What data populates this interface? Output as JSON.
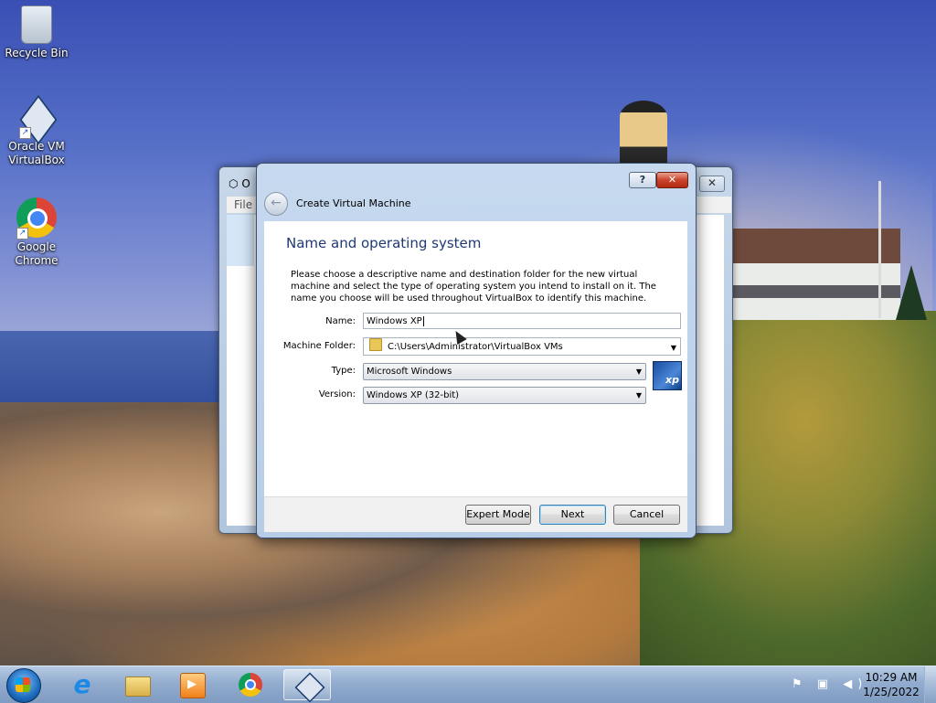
{
  "desktop": {
    "icons": [
      {
        "label": "Recycle Bin"
      },
      {
        "label": "Oracle VM\nVirtualBox"
      },
      {
        "label": "Google\nChrome"
      }
    ]
  },
  "background_window": {
    "title": "O",
    "menu_first": "File"
  },
  "dialog": {
    "title": "Create Virtual Machine",
    "help_label": "?",
    "close_label": "✕",
    "back_label": "←",
    "heading": "Name and operating system",
    "description": "Please choose a descriptive name and destination folder for the new virtual machine and select the type of operating system you intend to install on it. The name you choose will be used throughout VirtualBox to identify this machine.",
    "name_label": "Name:",
    "name_value": "Windows XP",
    "folder_label": "Machine Folder:",
    "folder_value": "C:\\Users\\Administrator\\VirtualBox VMs",
    "type_label": "Type:",
    "type_value": "Microsoft Windows",
    "version_label": "Version:",
    "version_value": "Windows XP (32-bit)",
    "os_logo_text": "xp",
    "buttons": {
      "expert": "Expert Mode",
      "next": "Next",
      "cancel": "Cancel"
    }
  },
  "taskbar": {
    "ie_glyph": "e",
    "tray_icons": "⚑ ▣ ◀)",
    "clock_time": "10:29 AM",
    "clock_date": "1/25/2022"
  },
  "colors": {
    "heading": "#1e3a73",
    "close_button": "#c9432b",
    "default_button_border": "#3c7fb1"
  }
}
